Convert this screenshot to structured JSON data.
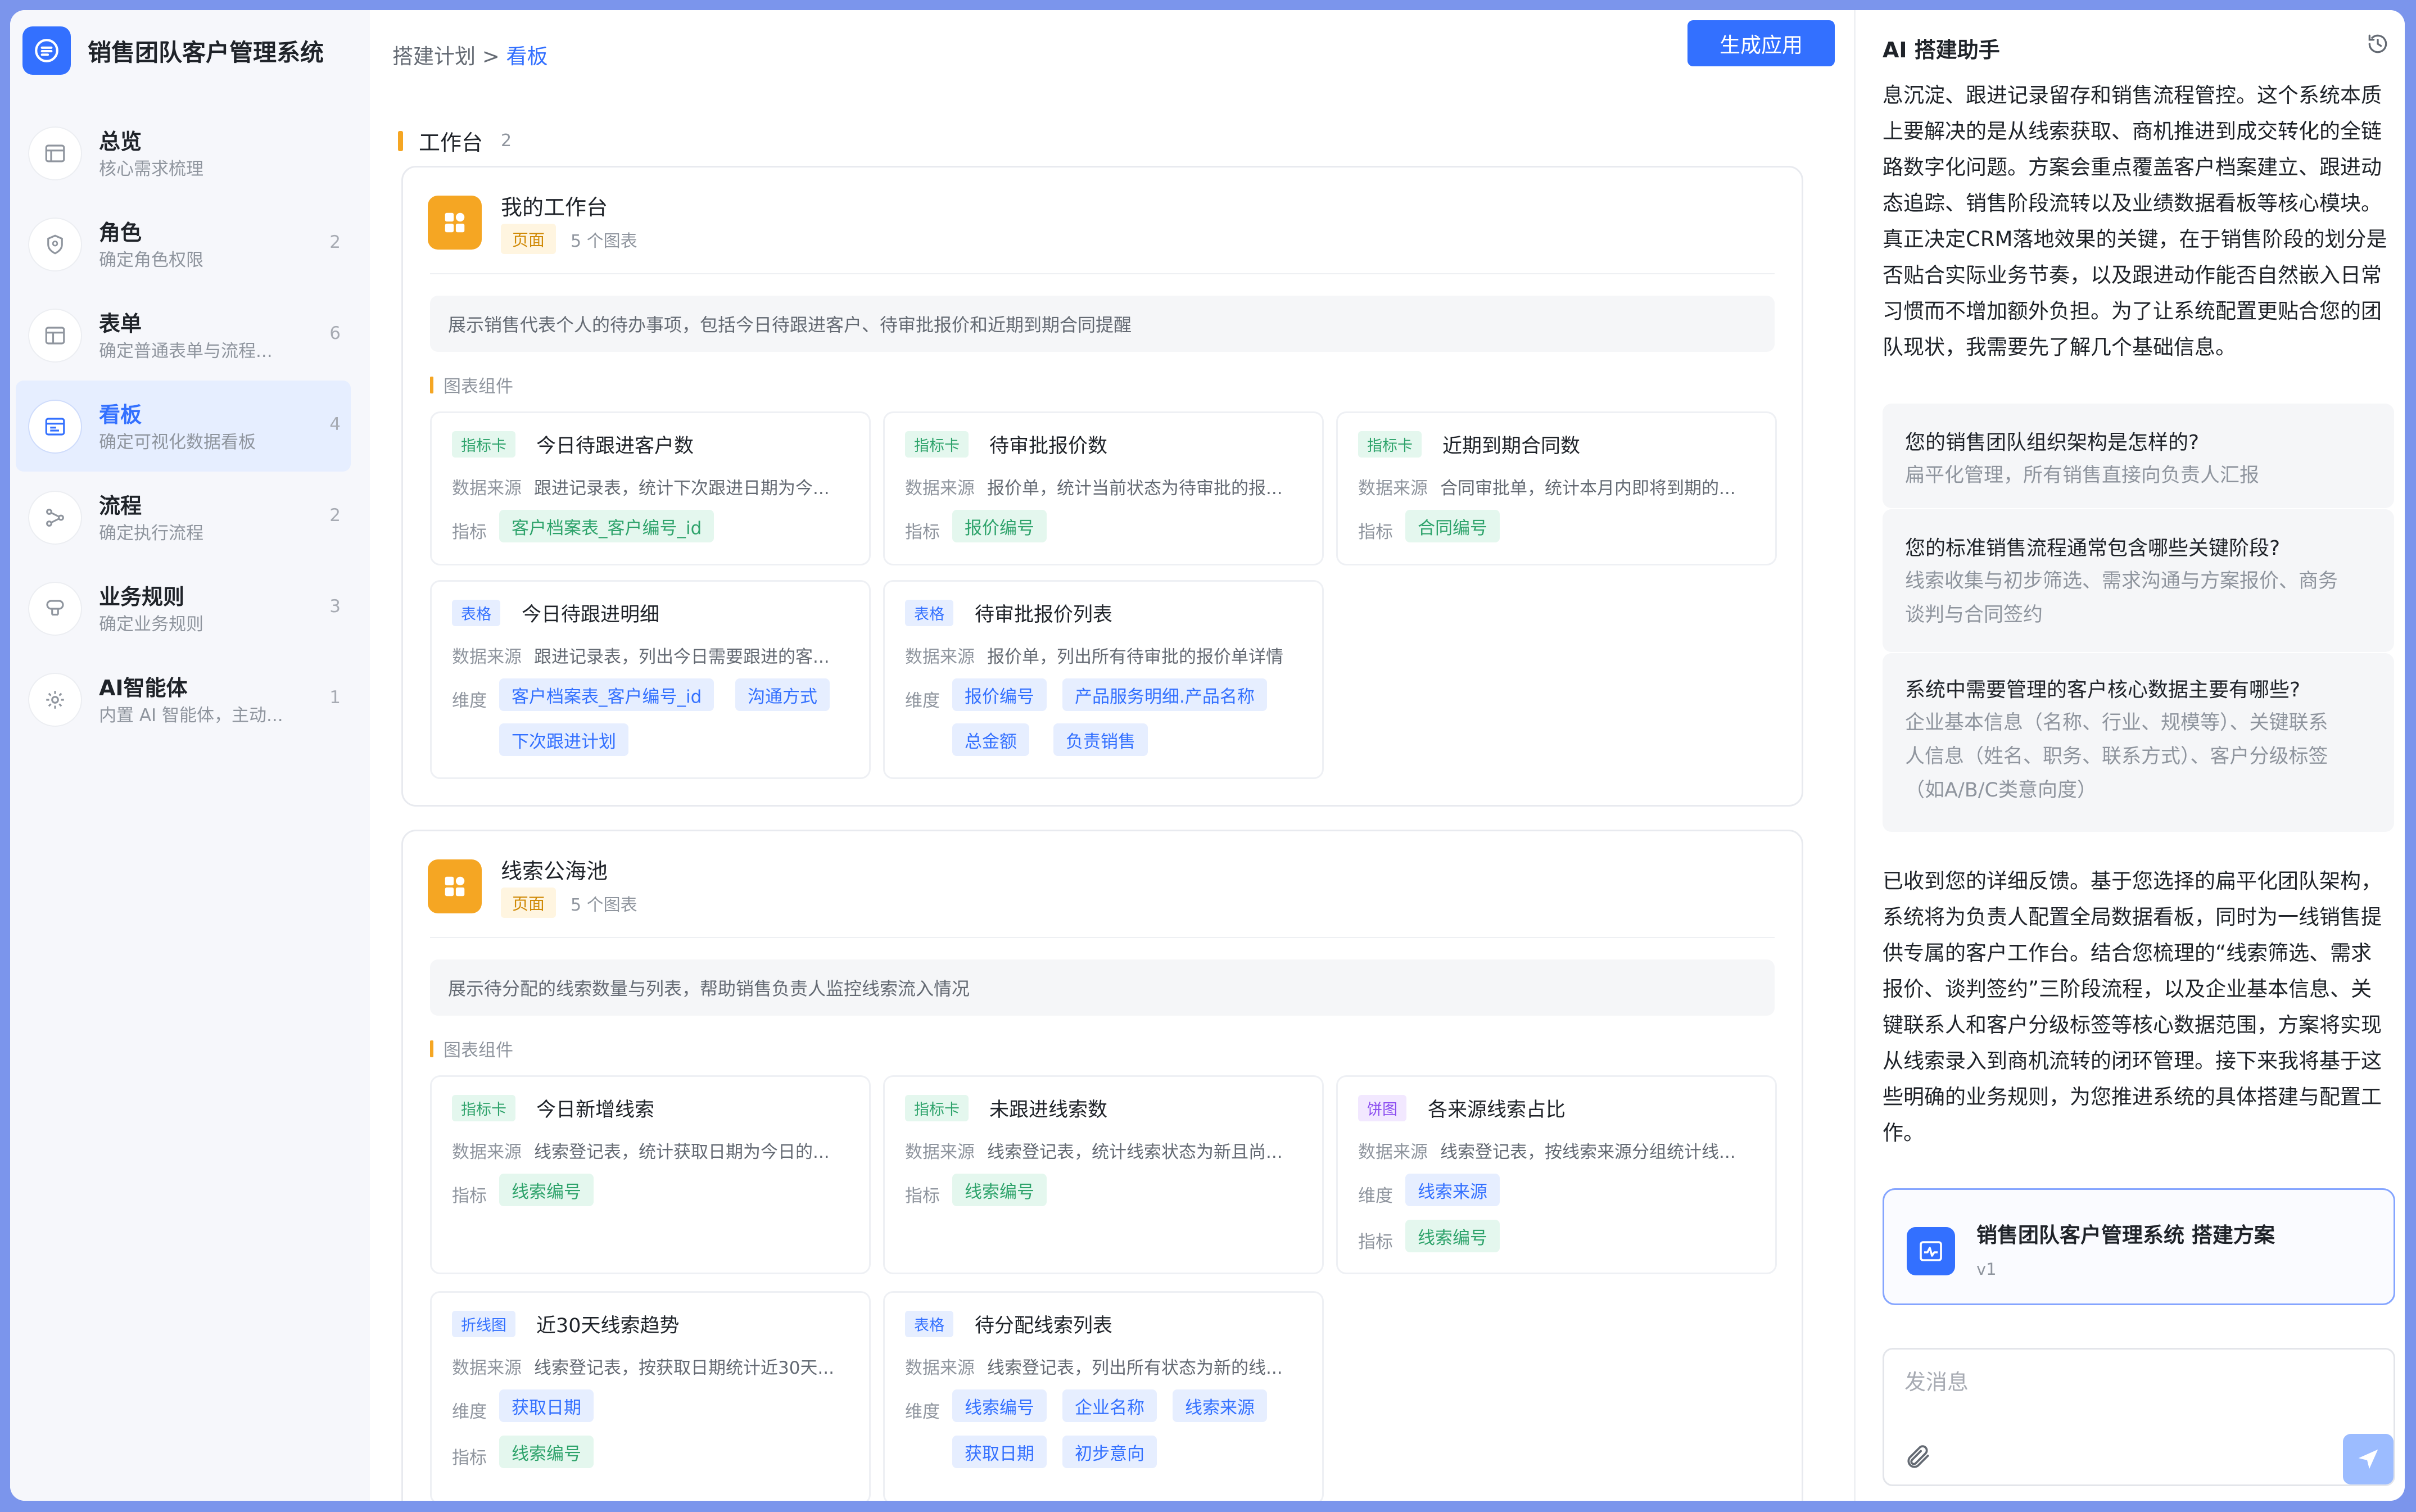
{
  "app": {
    "title": "销售团队客户管理系统"
  },
  "sidebar": {
    "items": [
      {
        "title": "总览",
        "subtitle": "核心需求梳理",
        "count": ""
      },
      {
        "title": "角色",
        "subtitle": "确定角色权限",
        "count": "2"
      },
      {
        "title": "表单",
        "subtitle": "确定普通表单与流程...",
        "count": "6"
      },
      {
        "title": "看板",
        "subtitle": "确定可视化数据看板",
        "count": "4"
      },
      {
        "title": "流程",
        "subtitle": "确定执行流程",
        "count": "2"
      },
      {
        "title": "业务规则",
        "subtitle": "确定业务规则",
        "count": "3"
      },
      {
        "title": "AI智能体",
        "subtitle": "内置 AI 智能体，主动...",
        "count": "1"
      }
    ]
  },
  "header": {
    "crumb_parent": "搭建计划",
    "crumb_sep": ">",
    "crumb_current": "看板",
    "generate_label": "生成应用"
  },
  "section": {
    "title": "工作台",
    "count": "2"
  },
  "labels": {
    "page_tag": "页面",
    "widgets_section": "图表组件",
    "source": "数据来源",
    "metric": "指标",
    "dimension": "维度"
  },
  "cards": [
    {
      "title": "我的工作台",
      "count": "5 个图表",
      "desc": "展示销售代表个人的待办事项，包括今日待跟进客户、待审批报价和近期到期合同提醒",
      "widgets": [
        {
          "type": "指标卡",
          "name": "今日待跟进客户数",
          "source": "跟进记录表，统计下次跟进日期为今...",
          "metrics": [
            "客户档案表_客户编号_id"
          ]
        },
        {
          "type": "指标卡",
          "name": "待审批报价数",
          "source": "报价单，统计当前状态为待审批的报...",
          "metrics": [
            "报价编号"
          ]
        },
        {
          "type": "指标卡",
          "name": "近期到期合同数",
          "source": "合同审批单，统计本月内即将到期的...",
          "metrics": [
            "合同编号"
          ]
        },
        {
          "type": "表格",
          "name": "今日待跟进明细",
          "source": "跟进记录表，列出今日需要跟进的客...",
          "dims": [
            "客户档案表_客户编号_id",
            "沟通方式",
            "下次跟进计划"
          ]
        },
        {
          "type": "表格",
          "name": "待审批报价列表",
          "source": "报价单，列出所有待审批的报价单详情",
          "dims": [
            "报价编号",
            "产品服务明细.产品名称",
            "总金额",
            "负责销售"
          ]
        }
      ]
    },
    {
      "title": "线索公海池",
      "count": "5 个图表",
      "desc": "展示待分配的线索数量与列表，帮助销售负责人监控线索流入情况",
      "widgets": [
        {
          "type": "指标卡",
          "name": "今日新增线索",
          "source": "线索登记表，统计获取日期为今日的...",
          "metrics": [
            "线索编号"
          ]
        },
        {
          "type": "指标卡",
          "name": "未跟进线索数",
          "source": "线索登记表，统计线索状态为新且尚...",
          "metrics": [
            "线索编号"
          ]
        },
        {
          "type": "饼图",
          "name": "各来源线索占比",
          "source": "线索登记表，按线索来源分组统计线...",
          "dims": [
            "线索来源"
          ],
          "metrics": [
            "线索编号"
          ]
        },
        {
          "type": "折线图",
          "name": "近30天线索趋势",
          "source": "线索登记表，按获取日期统计近30天...",
          "dims": [
            "获取日期"
          ],
          "metrics": [
            "线索编号"
          ]
        },
        {
          "type": "表格",
          "name": "待分配线索列表",
          "source": "线索登记表，列出所有状态为新的线...",
          "dims": [
            "线索编号",
            "企业名称",
            "线索来源",
            "获取日期",
            "初步意向"
          ]
        }
      ]
    }
  ],
  "assistant": {
    "title": "AI 搭建助手",
    "intro_lines": [
      "息沉淀、跟进记录留存和销售流程管控。这个系统本质",
      "上要解决的是从线索获取、商机推进到成交转化的全链",
      "路数字化问题。方案会重点覆盖客户档案建立、跟进动",
      "态追踪、销售阶段流转以及业绩数据看板等核心模块。",
      "真正决定CRM落地效果的关键，在于销售阶段的划分是",
      "否贴合实际业务节奏，以及跟进动作能否自然嵌入日常",
      "习惯而不增加额外负担。为了让系统配置更贴合您的团",
      "队现状，我需要先了解几个基础信息。"
    ],
    "qa": [
      {
        "q": "您的销售团队组织架构是怎样的?",
        "a_lines": [
          "扁平化管理，所有销售直接向负责人汇报"
        ]
      },
      {
        "q": "您的标准销售流程通常包含哪些关键阶段?",
        "a_lines": [
          "线索收集与初步筛选、需求沟通与方案报价、商务",
          "谈判与合同签约"
        ]
      },
      {
        "q": "系统中需要管理的客户核心数据主要有哪些?",
        "a_lines": [
          "企业基本信息（名称、行业、规模等）、关键联系",
          "人信息（姓名、职务、联系方式）、客户分级标签",
          "（如A/B/C类意向度）"
        ]
      }
    ],
    "reply_lines": [
      "已收到您的详细反馈。基于您选择的扁平化团队架构，",
      "系统将为负责人配置全局数据看板，同时为一线销售提",
      "供专属的客户工作台。结合您梳理的“线索筛选、需求",
      "报价、谈判签约”三阶段流程，以及企业基本信息、关",
      "键联系人和客户分级标签等核心数据范围，方案将实现",
      "从线索录入到商机流转的闭环管理。接下来我将基于这",
      "些明确的业务规则，为您推进系统的具体搭建与配置工",
      "作。"
    ],
    "plan": {
      "title": "销售团队客户管理系统  搭建方案",
      "version": "v1"
    },
    "input": {
      "placeholder": "发消息"
    }
  },
  "colors": {
    "accent": "#3370ff",
    "page_bg": "#7b95ec",
    "orange": "#f5a623",
    "green": "#2ea36b"
  }
}
